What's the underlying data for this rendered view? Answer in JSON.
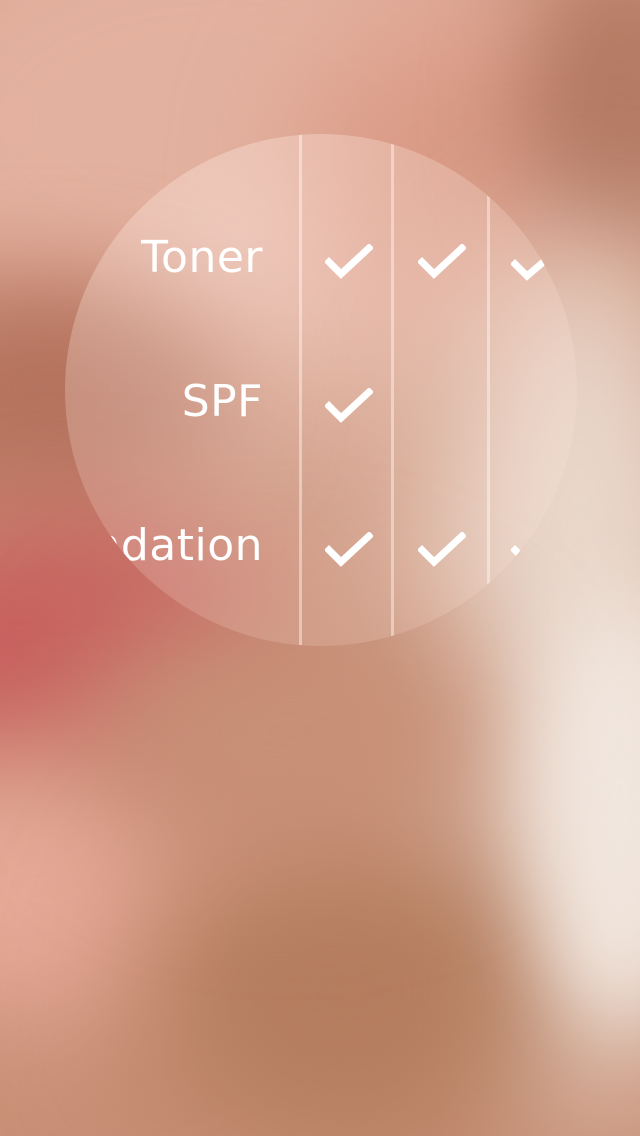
{
  "rows": [
    {
      "label": "Toner",
      "checks": [
        true,
        true,
        true
      ]
    },
    {
      "label": "SPF",
      "checks": [
        true,
        false,
        false
      ]
    },
    {
      "label": "ndation",
      "checks": [
        true,
        true,
        true
      ]
    }
  ],
  "icons": {
    "check": "checkmark-icon"
  },
  "colors": {
    "text": "#ffffff",
    "overlay": "rgba(255,230,220,0.25)"
  }
}
